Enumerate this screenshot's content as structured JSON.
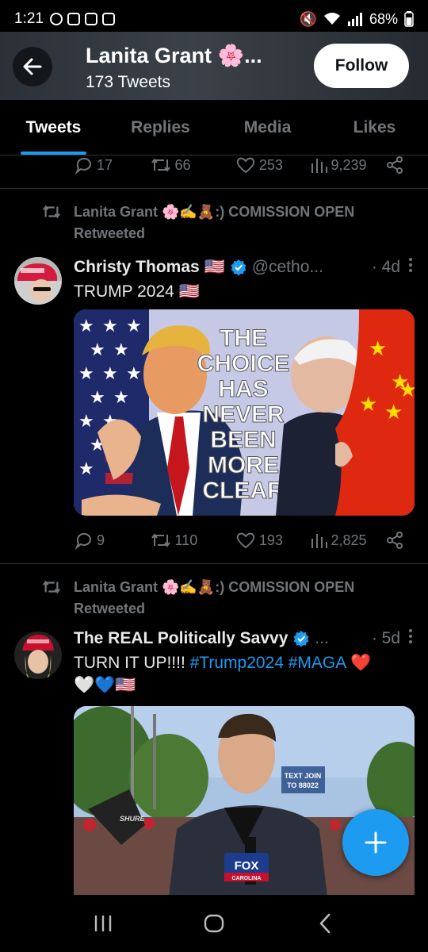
{
  "status_bar": {
    "time": "1:21",
    "battery": "68%"
  },
  "header": {
    "name": "Lanita Grant 🌸...",
    "tweet_count": "173 Tweets",
    "follow_label": "Follow"
  },
  "tabs": [
    {
      "label": "Tweets",
      "active": true
    },
    {
      "label": "Replies",
      "active": false
    },
    {
      "label": "Media",
      "active": false
    },
    {
      "label": "Likes",
      "active": false
    }
  ],
  "prev_tweet_actions": {
    "replies": "17",
    "retweets": "66",
    "likes": "253",
    "views": "9,239"
  },
  "tweets": [
    {
      "retweeted_by": "Lanita Grant 🌸✍️🧸:) COMISSION OPEN",
      "retweeted_label": "Retweeted",
      "name": "Christy Thomas 🇺🇸",
      "handle": "@cetho...",
      "time": "· 4d",
      "text": "TRUMP 2024 🇺🇸",
      "image_text": [
        "THE",
        "CHOICE",
        "HAS",
        "NEVER",
        "BEEN",
        "MORE",
        "CLEAR"
      ],
      "actions": {
        "replies": "9",
        "retweets": "110",
        "likes": "193",
        "views": "2,825"
      }
    },
    {
      "retweeted_by": "Lanita Grant 🌸✍️🧸:) COMISSION OPEN",
      "retweeted_label": "Retweeted",
      "name": "The REAL Politically Savvy",
      "handle": "...",
      "time": "· 5d",
      "text_prefix": "TURN IT UP!!!! ",
      "hashtag1": "#Trump2024",
      "hashtag2": " #MAGA",
      "text_suffix": " ❤️",
      "text_line2": "🤍💙🇺🇸",
      "video_overlay": {
        "text_join": "TEXT JOIN",
        "to_number": "TO 88022",
        "fox_label": "FOX",
        "fox_sub": "CAROLINA",
        "shure": "SHURE"
      }
    }
  ],
  "colors": {
    "accent": "#1d9bf0",
    "background": "#000000",
    "muted": "#71767b"
  }
}
